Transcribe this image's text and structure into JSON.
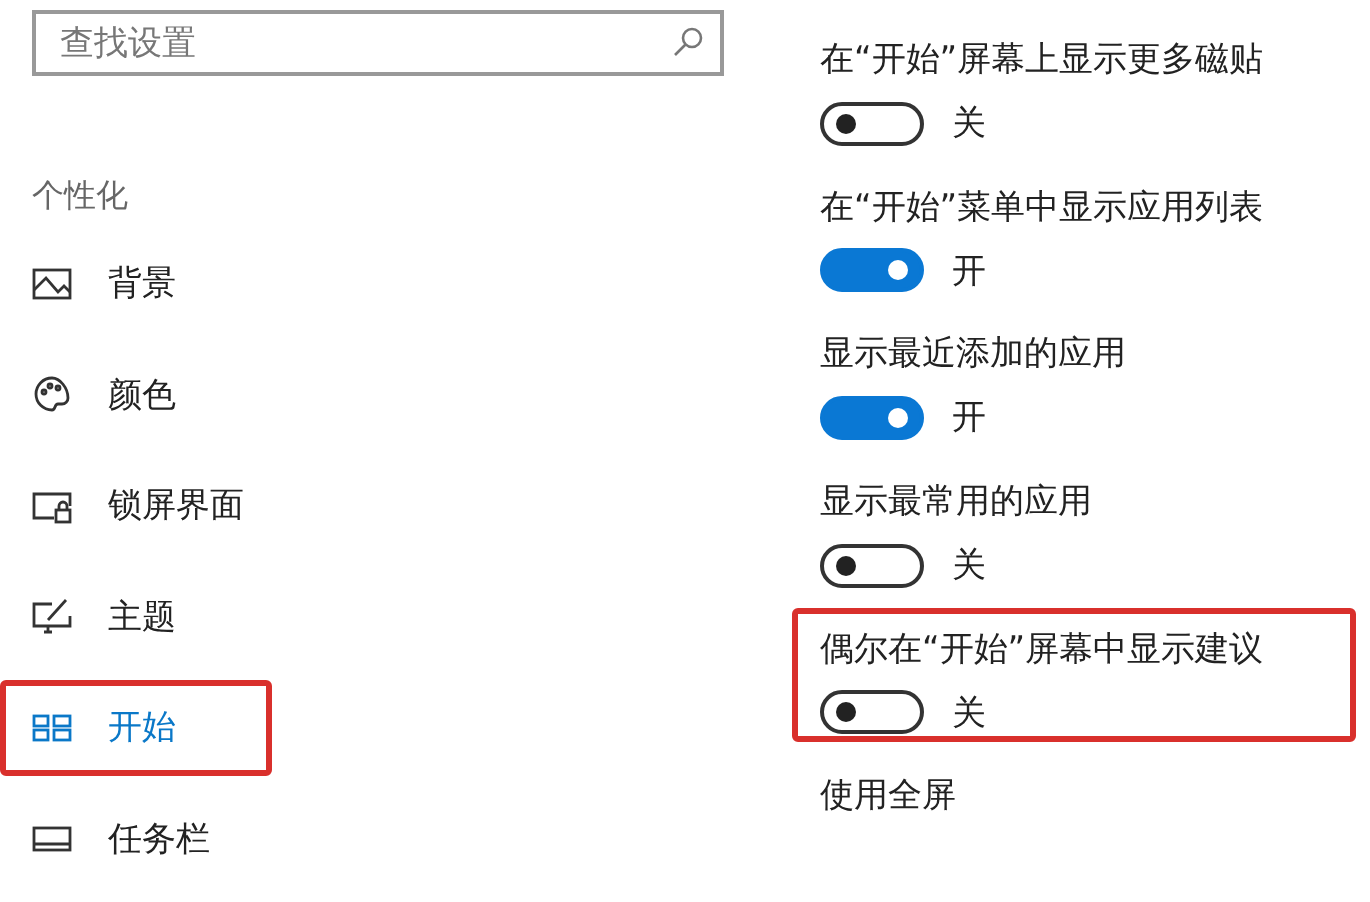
{
  "search": {
    "placeholder": "查找设置"
  },
  "sidebar": {
    "heading": "个性化",
    "items": [
      {
        "label": "背景",
        "kind": "picture",
        "selected": false,
        "highlighted": false
      },
      {
        "label": "颜色",
        "kind": "palette",
        "selected": false,
        "highlighted": false
      },
      {
        "label": "锁屏界面",
        "kind": "lockscreen",
        "selected": false,
        "highlighted": false
      },
      {
        "label": "主题",
        "kind": "theme",
        "selected": false,
        "highlighted": false
      },
      {
        "label": "开始",
        "kind": "start",
        "selected": true,
        "highlighted": true
      },
      {
        "label": "任务栏",
        "kind": "taskbar",
        "selected": false,
        "highlighted": false
      }
    ]
  },
  "settings": [
    {
      "title": "在“开始”屏幕上显示更多磁贴",
      "on": false,
      "state_label": "关",
      "highlighted": false
    },
    {
      "title": "在“开始”菜单中显示应用列表",
      "on": true,
      "state_label": "开",
      "highlighted": false
    },
    {
      "title": "显示最近添加的应用",
      "on": true,
      "state_label": "开",
      "highlighted": false
    },
    {
      "title": "显示最常用的应用",
      "on": false,
      "state_label": "关",
      "highlighted": false
    },
    {
      "title": "偶尔在“开始”屏幕中显示建议",
      "on": false,
      "state_label": "关",
      "highlighted": true
    },
    {
      "title": "使用全屏",
      "highlighted": false
    }
  ]
}
